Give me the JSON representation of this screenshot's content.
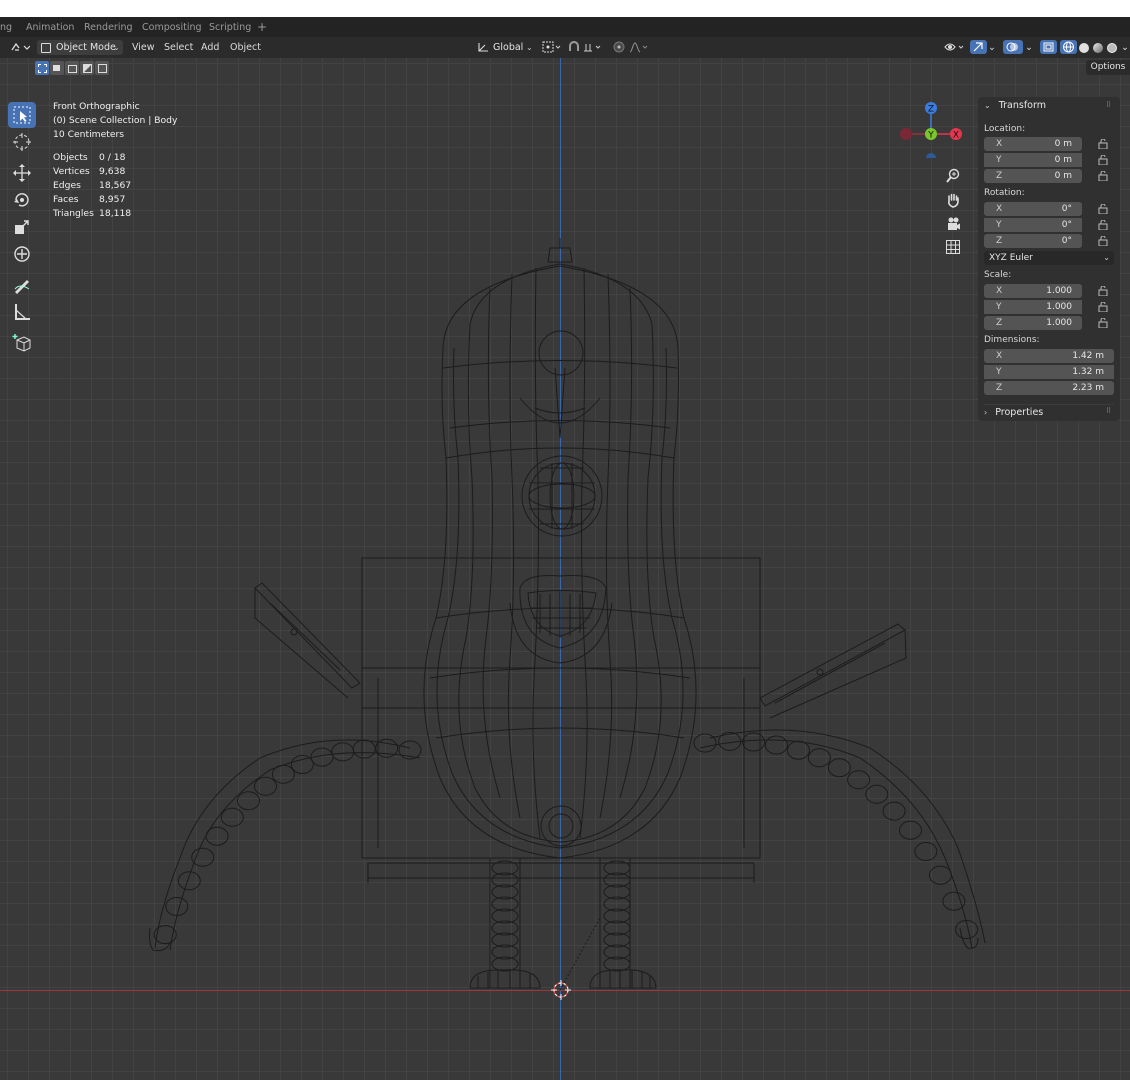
{
  "topbar": {
    "tabs": [
      "ng",
      "Animation",
      "Rendering",
      "Compositing",
      "Scripting",
      "+"
    ]
  },
  "header": {
    "mode": "Object Mode",
    "menus": [
      "View",
      "Select",
      "Add",
      "Object"
    ],
    "transform_orientation": "Global",
    "options_label": "Options"
  },
  "overlay": {
    "view_name": "Front Orthographic",
    "collection": "(0) Scene Collection | Body",
    "grid_scale": "10 Centimeters",
    "stats": [
      {
        "label": "Objects",
        "value": "0 / 18"
      },
      {
        "label": "Vertices",
        "value": "9,638"
      },
      {
        "label": "Edges",
        "value": "18,567"
      },
      {
        "label": "Faces",
        "value": "8,957"
      },
      {
        "label": "Triangles",
        "value": "18,118"
      }
    ]
  },
  "gizmo": {
    "z": "Z",
    "y": "Y",
    "x": "X"
  },
  "transform_panel": {
    "title": "Transform",
    "location_label": "Location:",
    "location": [
      {
        "axis": "X",
        "value": "0 m"
      },
      {
        "axis": "Y",
        "value": "0 m"
      },
      {
        "axis": "Z",
        "value": "0 m"
      }
    ],
    "rotation_label": "Rotation:",
    "rotation": [
      {
        "axis": "X",
        "value": "0°"
      },
      {
        "axis": "Y",
        "value": "0°"
      },
      {
        "axis": "Z",
        "value": "0°"
      }
    ],
    "rotation_mode": "XYZ Euler",
    "scale_label": "Scale:",
    "scale": [
      {
        "axis": "X",
        "value": "1.000"
      },
      {
        "axis": "Y",
        "value": "1.000"
      },
      {
        "axis": "Z",
        "value": "1.000"
      }
    ],
    "dimensions_label": "Dimensions:",
    "dimensions": [
      {
        "axis": "X",
        "value": "1.42 m"
      },
      {
        "axis": "Y",
        "value": "1.32 m"
      },
      {
        "axis": "Z",
        "value": "2.23 m"
      }
    ],
    "properties_label": "Properties"
  },
  "colors": {
    "accent": "#4772b3",
    "x_axis": "#e5364f",
    "y_axis": "#7bc62b",
    "z_axis": "#3a7de0",
    "wireframe": "#1a1a1a"
  }
}
